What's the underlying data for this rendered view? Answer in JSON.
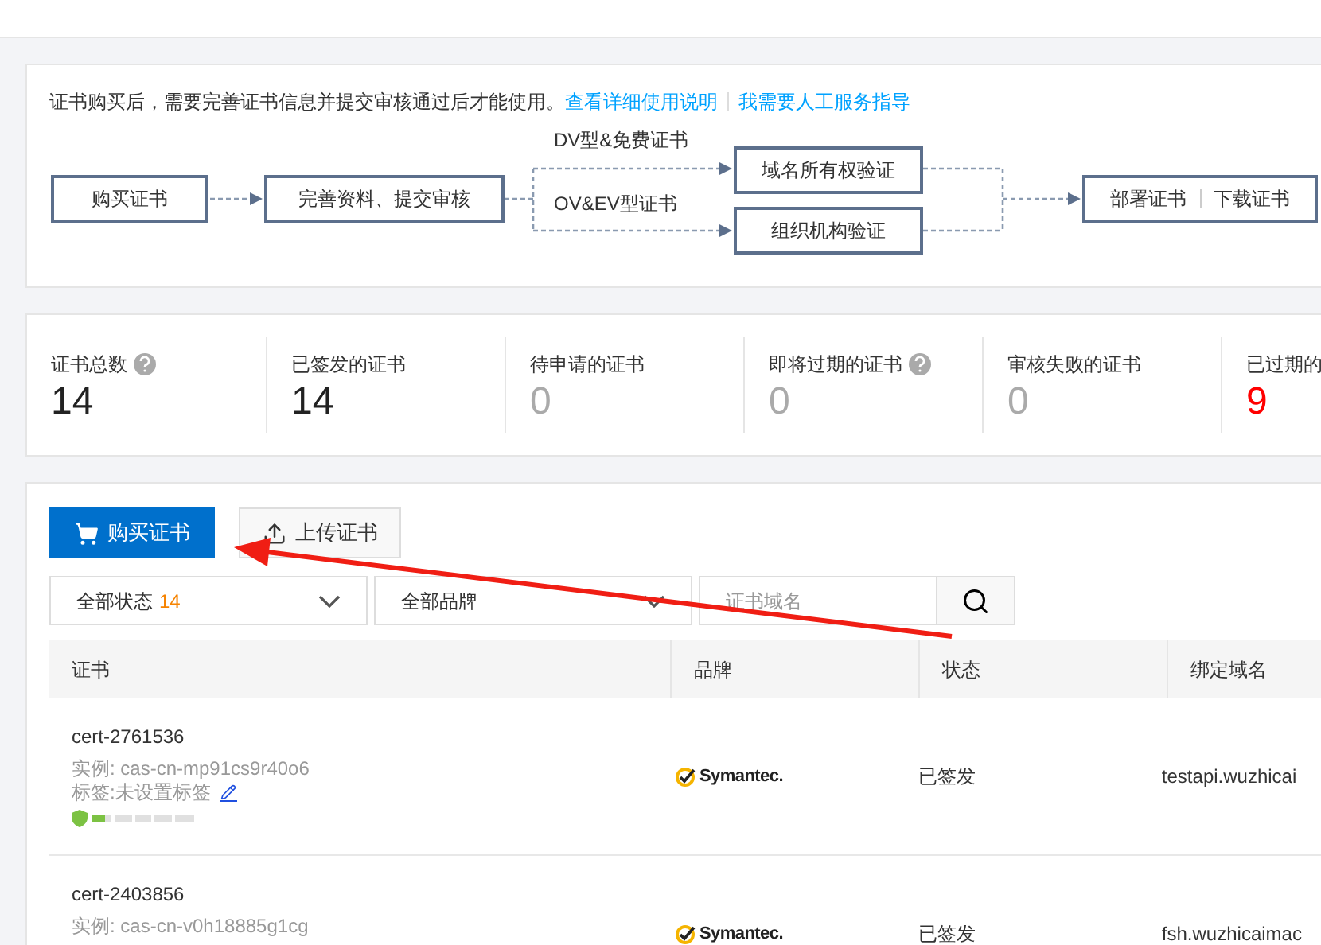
{
  "intro": {
    "text": "证书购买后，需要完善证书信息并提交审核通过后才能使用。",
    "links": [
      "查看详细使用说明",
      "我需要人工服务指导"
    ]
  },
  "flow": {
    "start": "购买证书",
    "submit": "完善资料、提交审核",
    "branches": [
      {
        "label": "DV型&免费证书",
        "step": "域名所有权验证"
      },
      {
        "label": "OV&EV型证书",
        "step": "组织机构验证"
      }
    ],
    "end": [
      "部署证书",
      "下载证书"
    ]
  },
  "stats": [
    {
      "label": "证书总数",
      "value": "14",
      "help": true,
      "kind": "dark"
    },
    {
      "label": "已签发的证书",
      "value": "14",
      "help": false,
      "kind": "dark"
    },
    {
      "label": "待申请的证书",
      "value": "0",
      "help": false,
      "kind": "muted"
    },
    {
      "label": "即将过期的证书",
      "value": "0",
      "help": true,
      "kind": "muted"
    },
    {
      "label": "审核失败的证书",
      "value": "0",
      "help": false,
      "kind": "muted"
    },
    {
      "label": "已过期的",
      "value": "9",
      "help": false,
      "kind": "alert"
    }
  ],
  "actions": [
    {
      "label": "购买证书",
      "kind": "primary"
    },
    {
      "label": "上传证书",
      "kind": "upload"
    }
  ],
  "filters": {
    "status": {
      "label": "全部状态",
      "count": "14"
    },
    "brand": {
      "label": "全部品牌"
    },
    "search": {
      "placeholder": "证书域名"
    }
  },
  "table": {
    "columns": [
      "证书",
      "品牌",
      "状态",
      "绑定域名"
    ],
    "rows": [
      {
        "name": "cert-2761536",
        "instance": "实例: cas-cn-mp91cs9r40o6",
        "tag": "标签:未设置标签",
        "security": {
          "level": 0.12
        },
        "brand": "Symantec.",
        "status": "已签发",
        "domain": "testapi.wuzhicai"
      },
      {
        "name": "cert-2403856",
        "instance": "实例: cas-cn-v0h18885g1cg",
        "brand": "Symantec.",
        "status": "已签发",
        "domain": "fsh.wuzhicaimac"
      }
    ]
  }
}
